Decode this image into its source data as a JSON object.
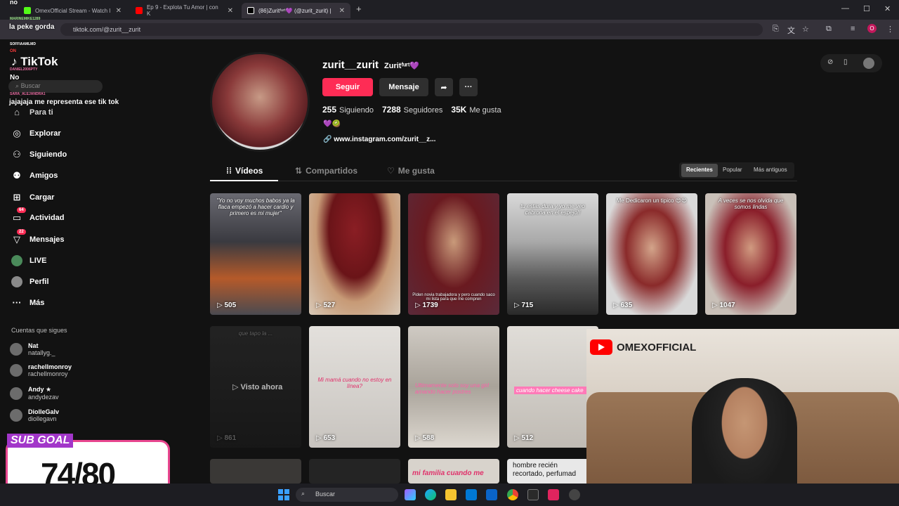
{
  "browser": {
    "tabs": [
      {
        "label": "OmexOfficial Stream - Watch l"
      },
      {
        "label": "Ep 9 - Explota Tu Amor | con K"
      },
      {
        "label": "(86)Zuritᶠᵘʳᵗ💜 (@zurit_zurit) |"
      }
    ],
    "url": "tiktok.com/@zurit__zurit"
  },
  "stream_overlay": {
    "chat": [
      {
        "user": "",
        "msg": "no"
      },
      {
        "user": "MARINEMIKE1289",
        "msg": "la peke gorda"
      },
      {
        "user": "SOFFIAAMLMD",
        "msg": "ON"
      },
      {
        "user": "DANIEL2006PTY",
        "msg": "No"
      },
      {
        "user": "SARA_ALEJANDRA1",
        "msg": "jajajaja me representa ese tik tok"
      }
    ],
    "subgoal_label": "SUB GOAL",
    "subgoal_count": "74/80",
    "cam_brand": "OMEXOFFICIAL"
  },
  "sidebar": {
    "logo": "TikTok",
    "search_placeholder": "Buscar",
    "nav": [
      {
        "label": "Para ti",
        "icon": "home-icon"
      },
      {
        "label": "Explorar",
        "icon": "compass-icon"
      },
      {
        "label": "Siguiendo",
        "icon": "following-icon"
      },
      {
        "label": "Amigos",
        "icon": "friends-icon"
      },
      {
        "label": "Cargar",
        "icon": "upload-icon"
      },
      {
        "label": "Actividad",
        "icon": "activity-icon",
        "badge": "64"
      },
      {
        "label": "Mensajes",
        "icon": "messages-icon",
        "badge": "22"
      },
      {
        "label": "LIVE",
        "icon": "live-icon"
      },
      {
        "label": "Perfil",
        "icon": "profile-icon"
      },
      {
        "label": "Más",
        "icon": "more-icon"
      }
    ],
    "following_header": "Cuentas que sigues",
    "following": [
      {
        "name": "Nat",
        "handle": "natallyg._"
      },
      {
        "name": "rachellmonroy",
        "handle": "rachellmonroy"
      },
      {
        "name": "Andy ★",
        "handle": "andydezav"
      },
      {
        "name": "DiolleGalv",
        "handle": "diollegavn"
      }
    ]
  },
  "profile": {
    "username": "zurit__zurit",
    "display_name": "Zuritᶠᵘʳᵗ💜",
    "follow_label": "Seguir",
    "message_label": "Mensaje",
    "stats": {
      "following": "255",
      "following_label": "Siguiendo",
      "followers": "7288",
      "followers_label": "Seguidores",
      "likes": "35K",
      "likes_label": "Me gusta"
    },
    "bio": "💜🥝",
    "link": "www.instagram.com/zurit__z..."
  },
  "tabs": {
    "videos": "Vídeos",
    "reposts": "Compartidos",
    "liked": "Me gusta"
  },
  "sort": {
    "recent": "Recientes",
    "popular": "Popular",
    "oldest": "Más antiguos"
  },
  "videos": [
    {
      "views": "505",
      "caption": "\"Yo no voy muchos babos ya la flaca empezó a hacer cardio y primero es mi mujer\""
    },
    {
      "views": "527",
      "caption": ""
    },
    {
      "views": "1739",
      "caption": "Piden novia trabajadora y pero cuando saco mi lista para que me compren"
    },
    {
      "views": "715",
      "caption": "tu estas dura y yo me veo cabrona en el espejo!!"
    },
    {
      "views": "635",
      "caption": "Me Dedicaron un tipico 😍😍"
    },
    {
      "views": "1047",
      "caption": "A veces se nos olvida que somos lindas"
    },
    {
      "views": "861",
      "caption": "que tapo la ..."
    },
    {
      "views": "653",
      "caption": "Mi mamá cuando no estoy en línea?"
    },
    {
      "views": "588",
      "caption": "Ultimamente solo soy una girl amando hacer postres"
    },
    {
      "views": "512",
      "caption": "cuando hacer cheese cake"
    }
  ],
  "watch_now": "Visto ahora",
  "row3": [
    {
      "caption": ""
    },
    {
      "caption": ""
    },
    {
      "caption": "mi familia cuando me"
    },
    {
      "caption": "hombre recién recortado, perfumad"
    }
  ],
  "taskbar": {
    "search": "Buscar"
  }
}
